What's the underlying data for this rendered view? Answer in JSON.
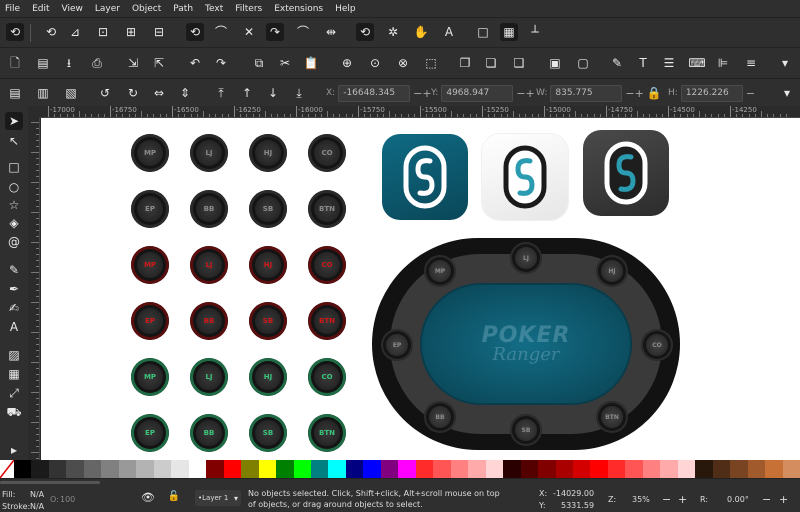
{
  "menu": [
    "File",
    "Edit",
    "View",
    "Layer",
    "Object",
    "Path",
    "Text",
    "Filters",
    "Extensions",
    "Help"
  ],
  "coords": {
    "x_label": "X:",
    "x_value": "-16648.345",
    "y_label": "Y:",
    "y_value": "4968.947",
    "w_label": "W:",
    "w_value": "835.775",
    "h_label": "H:",
    "h_value": "1226.226"
  },
  "ruler_ticks": [
    "-17000",
    "-16750",
    "-16500",
    "-16250",
    "-16000",
    "-15750",
    "-15500",
    "-15250",
    "-15000",
    "-14750",
    "-14500",
    "-14250"
  ],
  "buttons": {
    "rows": [
      {
        "style": "dark",
        "labels": [
          "MP",
          "LJ",
          "HJ",
          "CO"
        ]
      },
      {
        "style": "dark",
        "labels": [
          "EP",
          "BB",
          "SB",
          "BTN"
        ]
      },
      {
        "style": "red",
        "labels": [
          "MP",
          "LJ",
          "HJ",
          "CO"
        ]
      },
      {
        "style": "red",
        "labels": [
          "EP",
          "BB",
          "SB",
          "BTN"
        ]
      },
      {
        "style": "green",
        "labels": [
          "MP",
          "LJ",
          "HJ",
          "CO"
        ]
      },
      {
        "style": "green",
        "labels": [
          "EP",
          "BB",
          "SB",
          "BTN"
        ]
      }
    ]
  },
  "table": {
    "logo_top": "POKER",
    "logo_bottom": "Ranger",
    "seats": [
      "MP",
      "LJ",
      "HJ",
      "EP",
      "CO",
      "BB",
      "SB",
      "BTN"
    ]
  },
  "colors": {
    "teal": "#0d5e75",
    "dark_button": "#1c1c1c",
    "red_text": "#d01818",
    "green_text": "#3ac47a"
  },
  "palette": [
    "#000000",
    "#1a1a1a",
    "#333333",
    "#4d4d4d",
    "#666666",
    "#808080",
    "#999999",
    "#b3b3b3",
    "#cccccc",
    "#e6e6e6",
    "#ffffff",
    "#800000",
    "#ff0000",
    "#808000",
    "#ffff00",
    "#008000",
    "#00ff00",
    "#008080",
    "#00ffff",
    "#000080",
    "#0000ff",
    "#800080",
    "#ff00ff",
    "#ff2a2a",
    "#ff5555",
    "#ff8080",
    "#ffaaaa",
    "#ffd5d5",
    "#2b0000",
    "#550000",
    "#800000",
    "#aa0000",
    "#d40000",
    "#ff0000",
    "#ff2a2a",
    "#ff5555",
    "#ff8080",
    "#ffaaaa",
    "#ffd5d5",
    "#28170b",
    "#502d16",
    "#784421",
    "#a05a2c",
    "#c87137",
    "#d38d5f"
  ],
  "status": {
    "fill_label": "Fill:",
    "fill_value": "N/A",
    "stroke_label": "Stroke:",
    "stroke_value": "N/A",
    "opacity_label": "O:",
    "opacity_value": "100",
    "layer": "•Layer 1",
    "message_line1": "No objects selected. Click, Shift+click, Alt+scroll mouse on top",
    "message_line2": "of objects, or drag around objects to select.",
    "cursor_x_label": "X:",
    "cursor_x": "-14029.00",
    "cursor_y_label": "Y:",
    "cursor_y": "5331.59",
    "zoom_label": "Z:",
    "zoom": "35%",
    "rotate_label": "R:",
    "rotate": "0.00°"
  }
}
